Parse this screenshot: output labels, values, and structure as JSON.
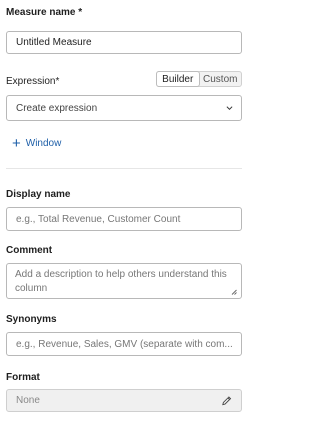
{
  "measure_name": {
    "label": "Measure name *",
    "value": "Untitled Measure"
  },
  "expression": {
    "label": "Expression*",
    "tabs": [
      "Builder",
      "Custom"
    ],
    "active_tab": "Builder",
    "placeholder": "Create expression",
    "window_link": "Window"
  },
  "display_name": {
    "label": "Display name",
    "placeholder": "e.g., Total Revenue, Customer Count"
  },
  "comment": {
    "label": "Comment",
    "placeholder": "Add a description to help others understand this column"
  },
  "synonyms": {
    "label": "Synonyms",
    "placeholder": "e.g., Revenue, Sales, GMV (separate with com..."
  },
  "format": {
    "label": "Format",
    "value": "None"
  },
  "colors": {
    "link": "#1e5fa8",
    "border": "#b8b8b8"
  },
  "icons": {
    "dropdown": "chevron-down-icon",
    "add": "plus-icon",
    "edit": "pencil-icon"
  }
}
